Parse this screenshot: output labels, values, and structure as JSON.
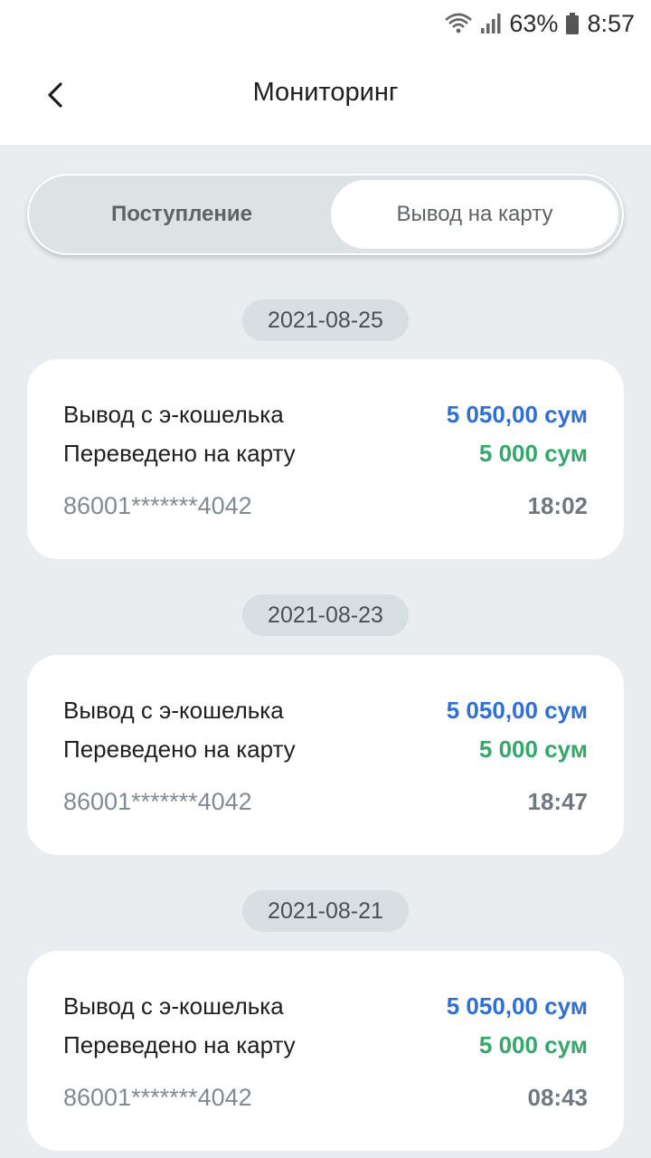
{
  "status": {
    "battery": "63%",
    "time": "8:57"
  },
  "header": {
    "title": "Мониторинг"
  },
  "segment": {
    "left": "Поступление",
    "right": "Вывод на карту"
  },
  "groups": [
    {
      "date": "2021-08-25",
      "label1": "Вывод с э-кошелька",
      "amount1": "5 050,00 сум",
      "label2": "Переведено на карту",
      "amount2": "5 000 сум",
      "card": "86001*******4042",
      "time": "18:02"
    },
    {
      "date": "2021-08-23",
      "label1": "Вывод с э-кошелька",
      "amount1": "5 050,00 сум",
      "label2": "Переведено на карту",
      "amount2": "5 000 сум",
      "card": "86001*******4042",
      "time": "18:47"
    },
    {
      "date": "2021-08-21",
      "label1": "Вывод с э-кошелька",
      "amount1": "5 050,00 сум",
      "label2": "Переведено на карту",
      "amount2": "5 000 сум",
      "card": "86001*******4042",
      "time": "08:43"
    }
  ]
}
